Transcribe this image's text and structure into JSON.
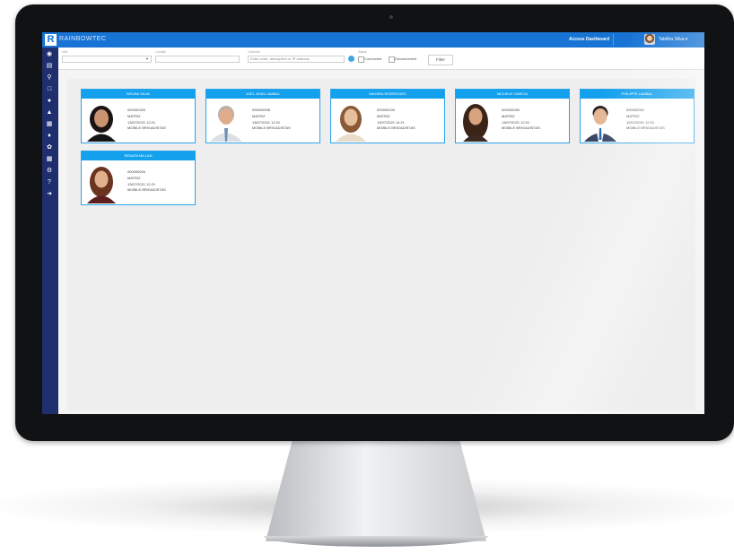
{
  "app": {
    "brand_logo": "R",
    "brand_name": "RAINBOWTEC",
    "access_dashboard": "Access Dashboard",
    "user_name": "Tabitha Silva ▾",
    "colors": {
      "topbar": "#1773d4",
      "sidebar": "#1f2f6e",
      "card_header": "#13a0ec"
    }
  },
  "sidebar": {
    "icons": [
      "dashboard-icon",
      "chart-icon",
      "key-icon",
      "document-icon",
      "users-icon",
      "user-icon",
      "calendar-icon",
      "cutlery-icon",
      "settings-icon",
      "print-icon",
      "gear-icon",
      "help-icon",
      "logout-icon"
    ]
  },
  "filters": {
    "unit_label": "Unit",
    "locality_label": "Locality",
    "collector_label": "Collector",
    "collector_placeholder": "Enter code, description or IP address",
    "status_label": "Status",
    "connected_label": "Connected",
    "disconnected_label": "Disconnected",
    "filter_button": "Filter"
  },
  "cards": [
    {
      "name": "BRUNA SILVA",
      "code": "000000320",
      "unit": "MATRIZ",
      "datetime": "13/07/2021 12:21",
      "group": "MOBILE BRIGADISTAS"
    },
    {
      "name": "JOEL JEAN LAMBAL",
      "code": "000000006",
      "unit": "MATRIZ",
      "datetime": "13/07/2021 12:21",
      "group": "MOBILE BRIGADISTAS"
    },
    {
      "name": "MAYARA RODRIGUES",
      "code": "000000100",
      "unit": "MATRIZ",
      "datetime": "13/07/2021 11:21",
      "group": "MOBILE BRIGADISTAS"
    },
    {
      "name": "MICHELE GARCIA",
      "code": "000000090",
      "unit": "MATRIZ",
      "datetime": "13/07/2021 12:21",
      "group": "MOBILE BRIGADISTAS"
    },
    {
      "name": "PHILIPPE LAMBAL",
      "code": "000000001",
      "unit": "MATRIZ",
      "datetime": "12/07/2021 12:21",
      "group": "MOBILE BRIGADISTAS"
    },
    {
      "name": "RENATA MILLAN",
      "code": "000000004",
      "unit": "MATRIZ",
      "datetime": "13/07/2021 12:21",
      "group": "MOBILE BRIGADISTAS"
    }
  ]
}
